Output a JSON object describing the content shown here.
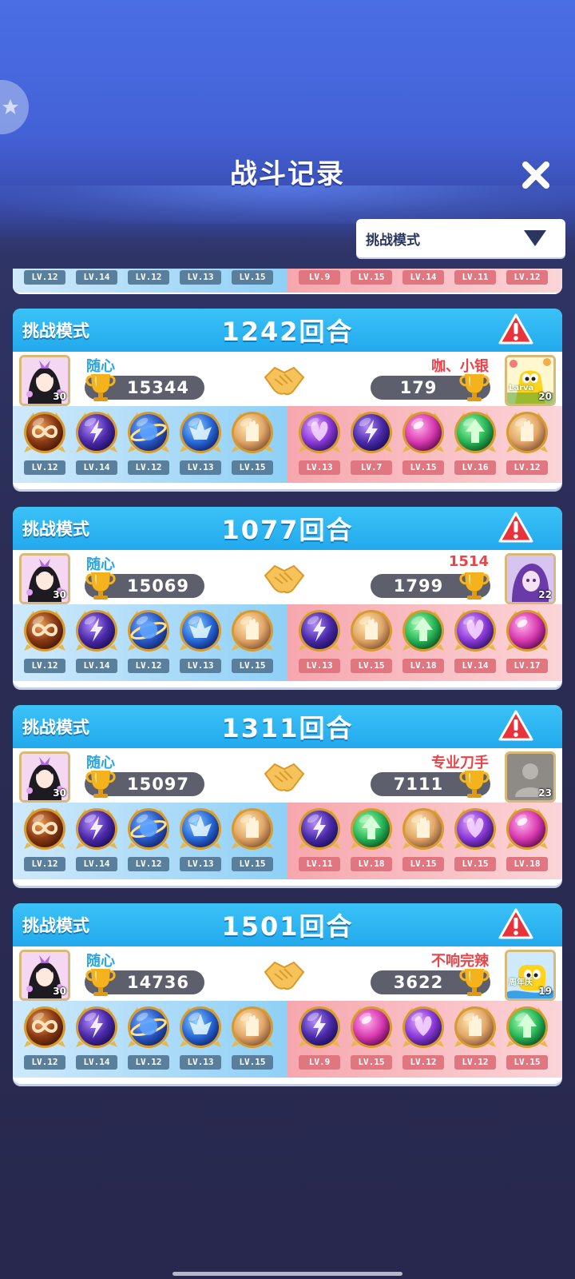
{
  "header": {
    "title": "战斗记录",
    "mode_select": "挑战模式"
  },
  "partial_card": {
    "left_levels": [
      "LV.12",
      "LV.14",
      "LV.12",
      "LV.13",
      "LV.15"
    ],
    "right_levels": [
      "LV.9",
      "LV.15",
      "LV.14",
      "LV.11",
      "LV.12"
    ]
  },
  "battles": [
    {
      "mode": "挑战模式",
      "rounds": "1242回合",
      "left": {
        "name": "随心",
        "score": "15344",
        "avatar_level": "30"
      },
      "right": {
        "name": "咖、小银",
        "score": "179",
        "avatar_level": "20",
        "avatar_text": "Larva"
      },
      "left_pets": [
        {
          "icon": "infinity-orb-icon",
          "level": "LV.12"
        },
        {
          "icon": "lightning-orb-icon",
          "level": "LV.14"
        },
        {
          "icon": "planet-orb-icon",
          "level": "LV.12"
        },
        {
          "icon": "crystal-orb-icon",
          "level": "LV.13"
        },
        {
          "icon": "hand-orb-icon",
          "level": "LV.15"
        }
      ],
      "right_pets": [
        {
          "icon": "butterfly-orb-icon",
          "level": "LV.13"
        },
        {
          "icon": "lightning-orb-icon",
          "level": "LV.7"
        },
        {
          "icon": "pink-orb-icon",
          "level": "LV.15"
        },
        {
          "icon": "arrow-orb-icon",
          "level": "LV.16"
        },
        {
          "icon": "hand-orb-icon",
          "level": "LV.12"
        }
      ]
    },
    {
      "mode": "挑战模式",
      "rounds": "1077回合",
      "left": {
        "name": "随心",
        "score": "15069",
        "avatar_level": "30"
      },
      "right": {
        "name": "1514",
        "score": "1799",
        "avatar_level": "22"
      },
      "left_pets": [
        {
          "icon": "infinity-orb-icon",
          "level": "LV.12"
        },
        {
          "icon": "lightning-orb-icon",
          "level": "LV.14"
        },
        {
          "icon": "planet-orb-icon",
          "level": "LV.12"
        },
        {
          "icon": "crystal-orb-icon",
          "level": "LV.13"
        },
        {
          "icon": "hand-orb-icon",
          "level": "LV.15"
        }
      ],
      "right_pets": [
        {
          "icon": "lightning-orb-icon",
          "level": "LV.13"
        },
        {
          "icon": "hand-orb-icon",
          "level": "LV.15"
        },
        {
          "icon": "arrow-orb-icon",
          "level": "LV.18"
        },
        {
          "icon": "butterfly-orb-icon",
          "level": "LV.14"
        },
        {
          "icon": "pink-orb-icon",
          "level": "LV.17"
        }
      ]
    },
    {
      "mode": "挑战模式",
      "rounds": "1311回合",
      "left": {
        "name": "随心",
        "score": "15097",
        "avatar_level": "30"
      },
      "right": {
        "name": "专业刀手",
        "score": "7111",
        "avatar_level": "23"
      },
      "left_pets": [
        {
          "icon": "infinity-orb-icon",
          "level": "LV.12"
        },
        {
          "icon": "lightning-orb-icon",
          "level": "LV.14"
        },
        {
          "icon": "planet-orb-icon",
          "level": "LV.12"
        },
        {
          "icon": "crystal-orb-icon",
          "level": "LV.13"
        },
        {
          "icon": "hand-orb-icon",
          "level": "LV.15"
        }
      ],
      "right_pets": [
        {
          "icon": "lightning-orb-icon",
          "level": "LV.11"
        },
        {
          "icon": "arrow-orb-icon",
          "level": "LV.18"
        },
        {
          "icon": "hand-orb-icon",
          "level": "LV.15"
        },
        {
          "icon": "butterfly-orb-icon",
          "level": "LV.15"
        },
        {
          "icon": "pink-orb-icon",
          "level": "LV.18"
        }
      ]
    },
    {
      "mode": "挑战模式",
      "rounds": "1501回合",
      "left": {
        "name": "随心",
        "score": "14736",
        "avatar_level": "30"
      },
      "right": {
        "name": "不响完辣",
        "score": "3622",
        "avatar_level": "19",
        "avatar_text": "周年庆"
      },
      "left_pets": [
        {
          "icon": "infinity-orb-icon",
          "level": "LV.12"
        },
        {
          "icon": "lightning-orb-icon",
          "level": "LV.14"
        },
        {
          "icon": "planet-orb-icon",
          "level": "LV.12"
        },
        {
          "icon": "crystal-orb-icon",
          "level": "LV.13"
        },
        {
          "icon": "hand-orb-icon",
          "level": "LV.15"
        }
      ],
      "right_pets": [
        {
          "icon": "lightning-orb-icon",
          "level": "LV.9"
        },
        {
          "icon": "pink-orb-icon",
          "level": "LV.15"
        },
        {
          "icon": "butterfly-orb-icon",
          "level": "LV.12"
        },
        {
          "icon": "hand-orb-icon",
          "level": "LV.12"
        },
        {
          "icon": "arrow-orb-icon",
          "level": "LV.15"
        }
      ]
    }
  ],
  "colors": {
    "header_blue": "#22a9ed",
    "left_name": "#2aa6e8",
    "right_name": "#e8454a",
    "warning_red": "#e8333c"
  }
}
